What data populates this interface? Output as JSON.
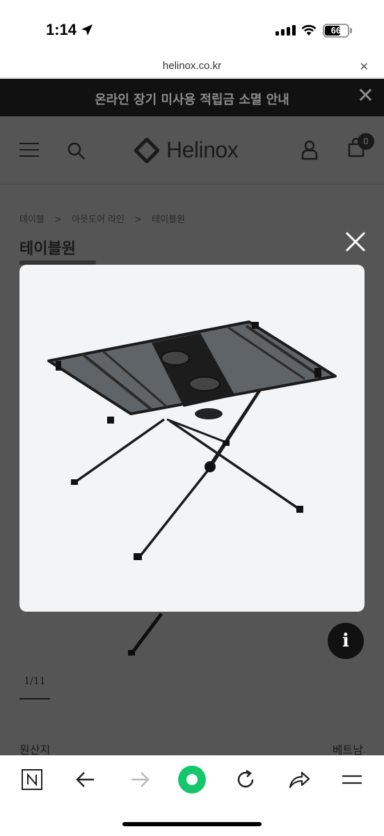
{
  "status_bar": {
    "time": "1:14",
    "battery": "66"
  },
  "browser": {
    "url": "helinox.co.kr"
  },
  "notice": {
    "text": "온라인 장기 미사용 적립금 소멸 안내"
  },
  "header": {
    "logo": "Helinox",
    "cart_count": "0"
  },
  "breadcrumb": {
    "items": [
      "테이블",
      ">",
      "아웃도어 라인",
      ">",
      "테이블원"
    ]
  },
  "product": {
    "title": "테이블원",
    "pager": "1/11",
    "origin_label": "원산지",
    "origin_value": "베트남"
  },
  "icons": {
    "menu": "hamburger-icon",
    "search": "search-icon",
    "user": "user-icon",
    "cart": "cart-icon",
    "info": "info-icon",
    "close": "close-icon"
  },
  "info_glyph": "i",
  "colors": {
    "accent_green": "#13c76a",
    "notice_bg": "#111111",
    "overlay": "#555555"
  }
}
